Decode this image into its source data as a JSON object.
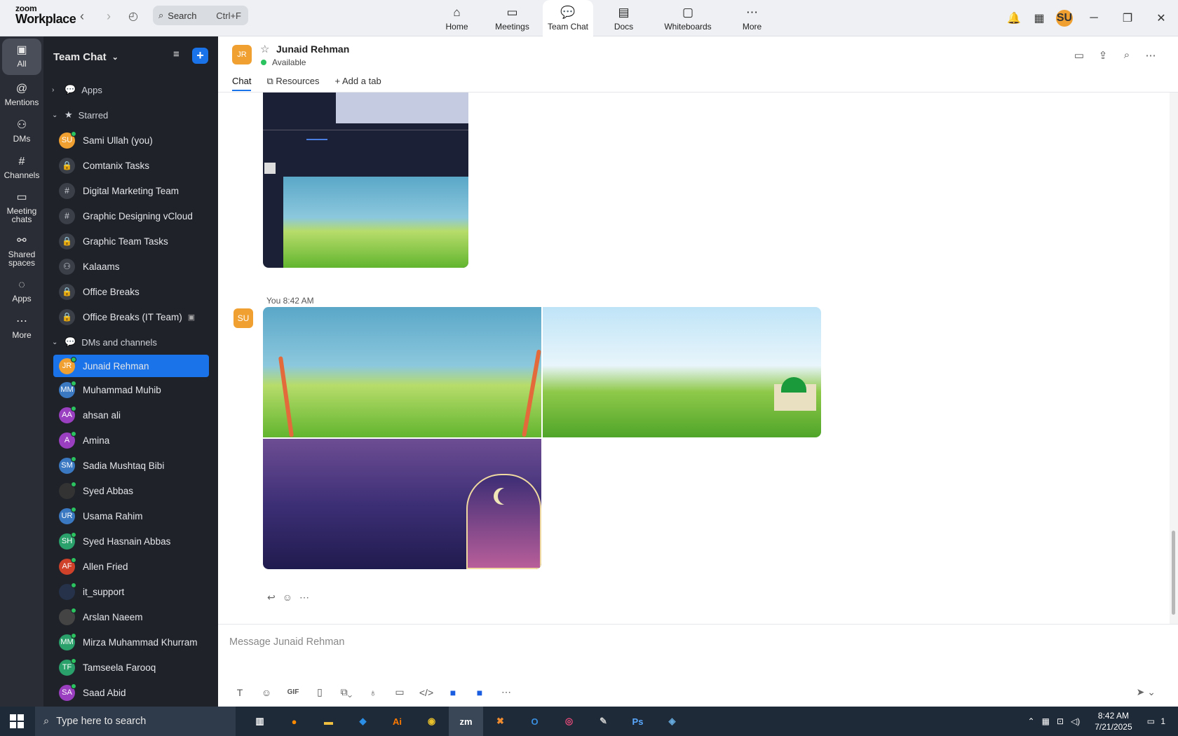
{
  "app": {
    "logo_top": "zoom",
    "logo_bottom": "Workplace"
  },
  "topbar": {
    "search_label": "Search",
    "search_shortcut": "Ctrl+F",
    "tabs": [
      {
        "label": "Home",
        "icon": "home-icon"
      },
      {
        "label": "Meetings",
        "icon": "video-icon"
      },
      {
        "label": "Team Chat",
        "icon": "chat-icon"
      },
      {
        "label": "Docs",
        "icon": "docs-icon"
      },
      {
        "label": "Whiteboards",
        "icon": "whiteboard-icon"
      },
      {
        "label": "More",
        "icon": "more-icon"
      }
    ],
    "user_initials": "SU"
  },
  "rail": [
    {
      "label": "All",
      "icon": "chat-bubble-icon"
    },
    {
      "label": "Mentions",
      "icon": "at-icon"
    },
    {
      "label": "DMs",
      "icon": "people-icon"
    },
    {
      "label": "Channels",
      "icon": "hash-icon"
    },
    {
      "label": "Meeting chats",
      "icon": "calendar-icon"
    },
    {
      "label": "Shared spaces",
      "icon": "share-icon"
    },
    {
      "label": "Apps",
      "icon": "apps-icon"
    },
    {
      "label": "More",
      "icon": "more-icon"
    }
  ],
  "sidebar": {
    "title": "Team Chat",
    "apps_label": "Apps",
    "starred_label": "Starred",
    "starred": [
      {
        "label": "Sami Ullah (you)",
        "initials": "SU",
        "color": "#f0a030",
        "type": "user"
      },
      {
        "label": "Comtanix Tasks",
        "type": "lock"
      },
      {
        "label": "Digital Marketing Team",
        "type": "hash"
      },
      {
        "label": "Graphic Designing vCloud",
        "type": "hash"
      },
      {
        "label": "Graphic Team Tasks",
        "type": "lock"
      },
      {
        "label": "Kalaams",
        "type": "group"
      },
      {
        "label": "Office Breaks",
        "type": "lock"
      },
      {
        "label": "Office Breaks (IT Team)",
        "type": "lock"
      }
    ],
    "dms_label": "DMs and channels",
    "dms": [
      {
        "label": "Junaid Rehman",
        "initials": "JR",
        "color": "#f0a030"
      },
      {
        "label": "Muhammad Muhib",
        "initials": "MM",
        "color": "#3a78c2"
      },
      {
        "label": "ahsan ali",
        "initials": "AA",
        "color": "#9a3fc0"
      },
      {
        "label": "Amina",
        "initials": "A",
        "color": "#9a3fc0"
      },
      {
        "label": "Sadia Mushtaq Bibi",
        "initials": "SM",
        "color": "#3a78c2"
      },
      {
        "label": "Syed Abbas",
        "initials": "",
        "color": "#333"
      },
      {
        "label": "Usama Rahim",
        "initials": "UR",
        "color": "#3a78c2"
      },
      {
        "label": "Syed Hasnain Abbas",
        "initials": "SH",
        "color": "#2aa06a"
      },
      {
        "label": "Allen Fried",
        "initials": "AF",
        "color": "#d0412a"
      },
      {
        "label": "it_support",
        "initials": "",
        "color": "#25324a"
      },
      {
        "label": "Arslan Naeem",
        "initials": "",
        "color": "#444"
      },
      {
        "label": "Mirza Muhammad Khurram",
        "initials": "MM",
        "color": "#2aa06a"
      },
      {
        "label": "Tamseela Farooq",
        "initials": "TF",
        "color": "#2aa06a"
      },
      {
        "label": "Saad Abid",
        "initials": "SA",
        "color": "#9a3fc0"
      }
    ]
  },
  "chat_header": {
    "initials": "JR",
    "name": "Junaid Rehman",
    "status": "Available",
    "tabs": [
      "Chat",
      "Resources",
      "Add a tab"
    ]
  },
  "message": {
    "sender": "You",
    "time": "8:42 AM",
    "avatar": "SU"
  },
  "compose": {
    "placeholder": "Message Junaid Rehman"
  },
  "taskbar": {
    "search_placeholder": "Type here to search",
    "time": "8:42 AM",
    "date": "7/21/2025",
    "notification_count": "1"
  },
  "colors": {
    "accent": "#1a73e8",
    "sidebar_bg": "#1f2229",
    "rail_bg": "#2a2d35",
    "presence": "#2bc35f"
  }
}
